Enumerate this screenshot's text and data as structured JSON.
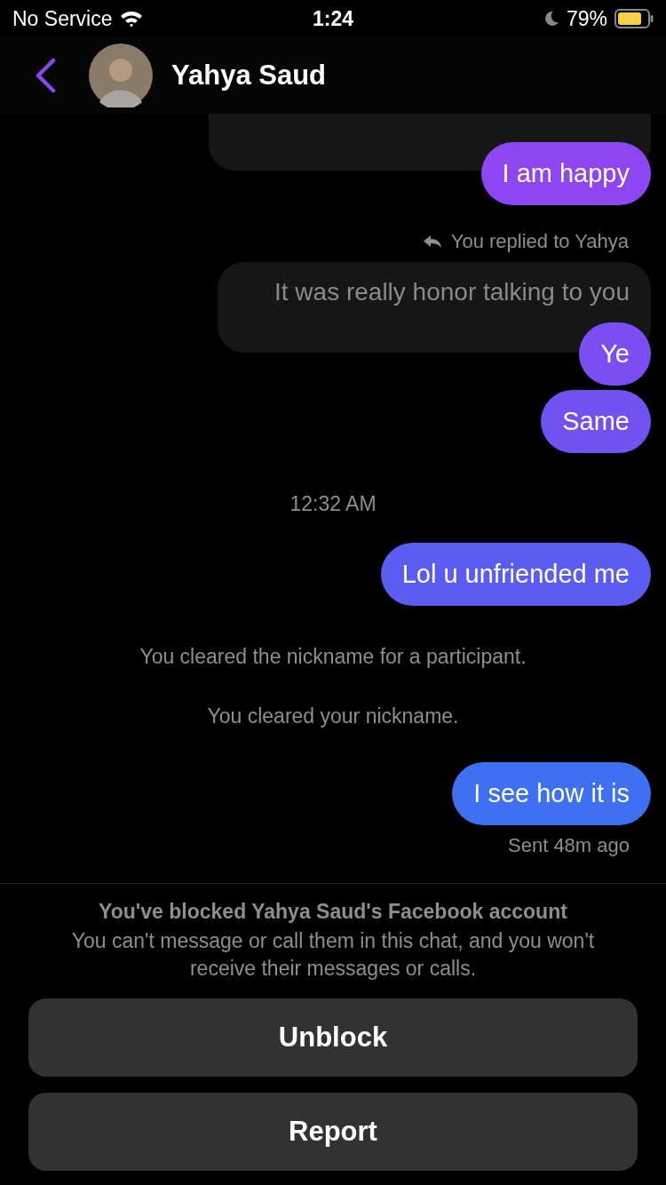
{
  "status_bar": {
    "carrier": "No Service",
    "time": "1:24",
    "battery": "79%"
  },
  "header": {
    "name": "Yahya Saud"
  },
  "messages": [
    {
      "kind": "quote_stub"
    },
    {
      "kind": "sent",
      "text": "I am happy",
      "color": "#8e45f2"
    },
    {
      "kind": "reply_label",
      "text": "You replied to Yahya"
    },
    {
      "kind": "quote",
      "text": "It was really honor talking to you"
    },
    {
      "kind": "sent",
      "text": "Ye",
      "color": "#7b4ef3",
      "overlap": true
    },
    {
      "kind": "sent",
      "text": "Same",
      "color": "#7151f2"
    },
    {
      "kind": "time",
      "text": "12:32 AM"
    },
    {
      "kind": "sent",
      "text": "Lol u unfriended me",
      "color": "#5a5cf2"
    },
    {
      "kind": "event",
      "text": "You cleared the nickname for a participant."
    },
    {
      "kind": "event",
      "text": "You cleared your nickname."
    },
    {
      "kind": "sent",
      "text": "I see how it is",
      "color": "#3f6ff2"
    },
    {
      "kind": "receipt",
      "text": "Sent 48m ago"
    }
  ],
  "blocked": {
    "title": "You've blocked Yahya Saud's Facebook account",
    "body": "You can't message or call them in this chat, and you won't receive their messages or calls."
  },
  "buttons": [
    "Unblock",
    "Report"
  ]
}
